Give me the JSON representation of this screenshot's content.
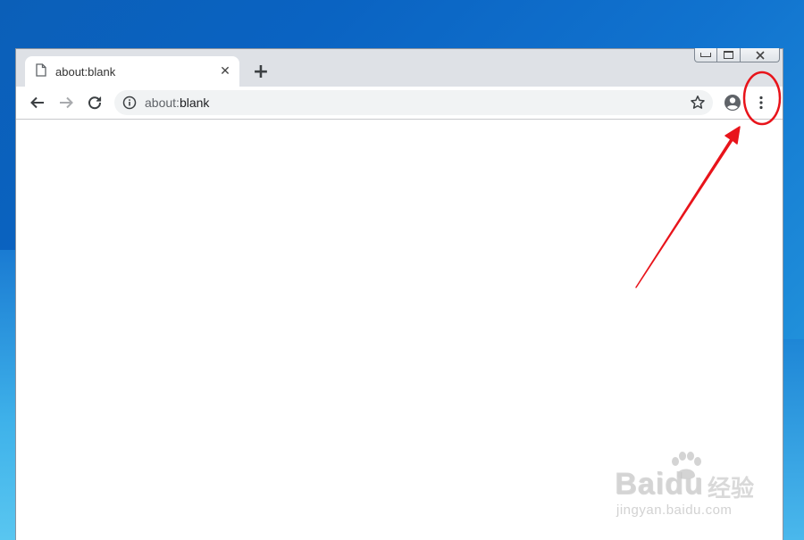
{
  "browser": {
    "tab": {
      "title": "about:blank",
      "close_glyph": "✕",
      "icon": "page-icon"
    },
    "new_tab_glyph": "+",
    "omnibox": {
      "prefix": "about:",
      "host": "blank",
      "info_icon": "info-icon",
      "star_icon": "star-icon"
    },
    "toolbar_icons": [
      "back-arrow-icon",
      "forward-arrow-icon",
      "reload-icon",
      "profile-icon",
      "kebab-menu-icon"
    ],
    "window_controls": [
      "minimize",
      "restore",
      "close"
    ]
  },
  "annotation": {
    "color": "#e8141b",
    "target": "kebab-menu-button"
  },
  "watermark": {
    "brand_latin": "Baidu",
    "brand_cn": "经验",
    "url": "jingyan.baidu.com"
  },
  "colors": {
    "tab_strip": "#dee1e6",
    "toolbar": "#ffffff",
    "omnibox": "#f1f3f4",
    "icon": "#5f6368"
  }
}
